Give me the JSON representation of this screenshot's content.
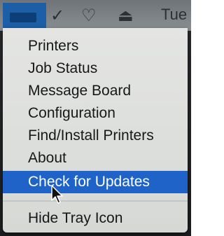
{
  "menubar": {
    "icons": [
      "printer-tray-icon",
      "checkmark-icon",
      "heart-icon",
      "eject-icon"
    ],
    "clock": "Tue"
  },
  "menu": {
    "items": [
      {
        "label": "Printers"
      },
      {
        "label": "Job Status"
      },
      {
        "label": "Message Board"
      },
      {
        "label": "Configuration"
      },
      {
        "label": "Find/Install Printers"
      },
      {
        "label": "About"
      },
      {
        "label": "Check for Updates",
        "selected": true
      },
      {
        "label": "Hide Tray Icon"
      }
    ]
  },
  "colors": {
    "selection": "#1f63c9",
    "menu_bg": "#e0e1df",
    "text": "#16181a"
  }
}
